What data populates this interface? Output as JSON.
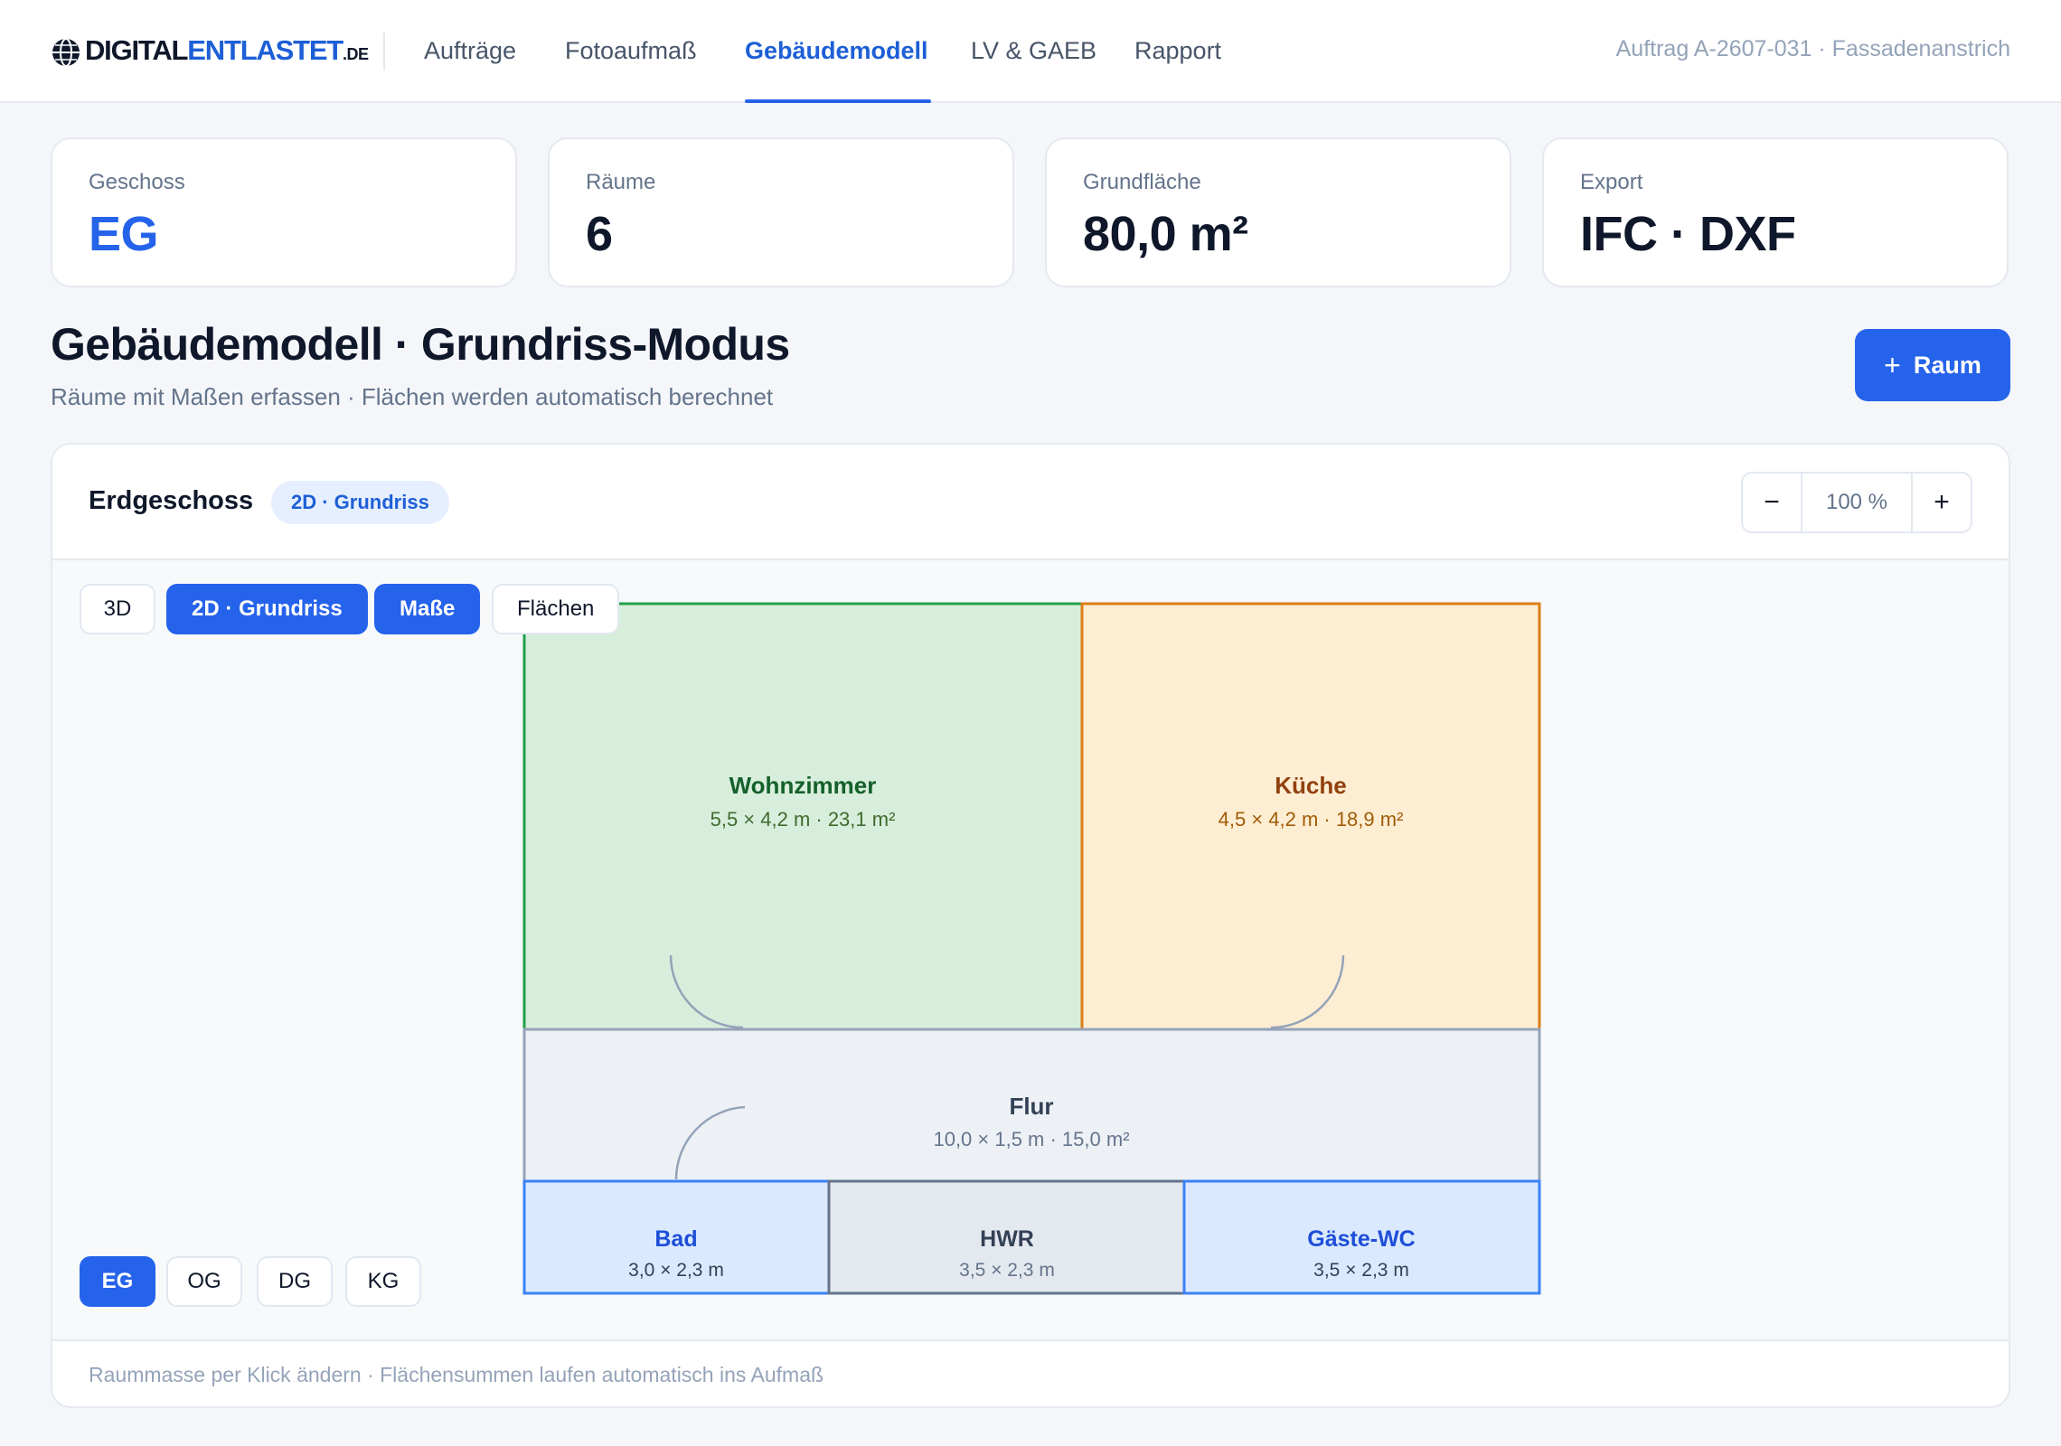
{
  "brand": {
    "logo_part1": "DIGITAL",
    "logo_part2": "ENTLASTET",
    "logo_part3": ".DE",
    "accent_color": "#2563eb"
  },
  "nav": {
    "items": [
      {
        "label": "Aufträge",
        "active": false
      },
      {
        "label": "Fotoaufmaß",
        "active": false
      },
      {
        "label": "Gebäudemodell",
        "active": true
      },
      {
        "label": "LV & GAEB",
        "active": false
      },
      {
        "label": "Rapport",
        "active": false
      }
    ],
    "job_ref": "Auftrag A-2607-031 · Fassadenanstrich"
  },
  "stats": [
    {
      "label": "Geschoss",
      "value": "EG"
    },
    {
      "label": "Räume",
      "value": "6"
    },
    {
      "label": "Grundfläche",
      "value": "80,0 m²"
    },
    {
      "label": "Export",
      "value": "IFC · DXF"
    }
  ],
  "header": {
    "title": "Gebäudemodell · Grundriss-Modus",
    "subtitle": "Räume mit Maßen erfassen · Flächen werden automatisch berechnet",
    "add_button_icon": "plus-icon",
    "add_button_label": "Raum"
  },
  "panel": {
    "floor_title": "Erdgeschoss",
    "mode_badge": "2D · Grundriss",
    "zoom": {
      "minus": "−",
      "value": "100 %",
      "plus": "+"
    },
    "view_buttons": [
      {
        "label": "3D",
        "active": false
      },
      {
        "label": "2D · Grundriss",
        "active": true
      },
      {
        "label": "Maße",
        "active": true
      },
      {
        "label": "Flächen",
        "active": false
      }
    ],
    "floor_buttons": [
      {
        "label": "EG",
        "active": true
      },
      {
        "label": "OG",
        "active": false
      },
      {
        "label": "DG",
        "active": false
      },
      {
        "label": "KG",
        "active": false
      }
    ],
    "footer_text": "Raummasse per Klick ändern · Flächensummen laufen automatisch ins Aufmaß"
  },
  "rooms": [
    {
      "name": "Wohnzimmer",
      "dims": "5,5 × 4,2 m · 23,1 m²",
      "fill": "#d8eedc",
      "stroke": "#22a04b",
      "name_color": "#15602b",
      "dim_color": "#3f6b2e"
    },
    {
      "name": "Küche",
      "dims": "4,5 × 4,2 m · 18,9 m²",
      "fill": "#fdeed3",
      "stroke": "#db7f16",
      "name_color": "#92400e",
      "dim_color": "#a15c07"
    },
    {
      "name": "Flur",
      "dims": "10,0 × 1,5 m · 15,0 m²",
      "fill": "#edf1f6",
      "stroke": "#94a3b8",
      "name_color": "#334155",
      "dim_color": "#64748b"
    },
    {
      "name": "Bad",
      "dims": "3,0 × 2,3 m",
      "fill": "#dbe9fe",
      "stroke": "#3b82f6",
      "name_color": "#1d4ed8",
      "dim_color": "#334155"
    },
    {
      "name": "HWR",
      "dims": "3,5 × 2,3 m",
      "fill": "#e4e8ef",
      "stroke": "#64748b",
      "name_color": "#334155",
      "dim_color": "#64748b"
    },
    {
      "name": "Gäste-WC",
      "dims": "3,5 × 2,3 m",
      "fill": "#dbe9fe",
      "stroke": "#3b82f6",
      "name_color": "#1d4ed8",
      "dim_color": "#334155"
    }
  ]
}
